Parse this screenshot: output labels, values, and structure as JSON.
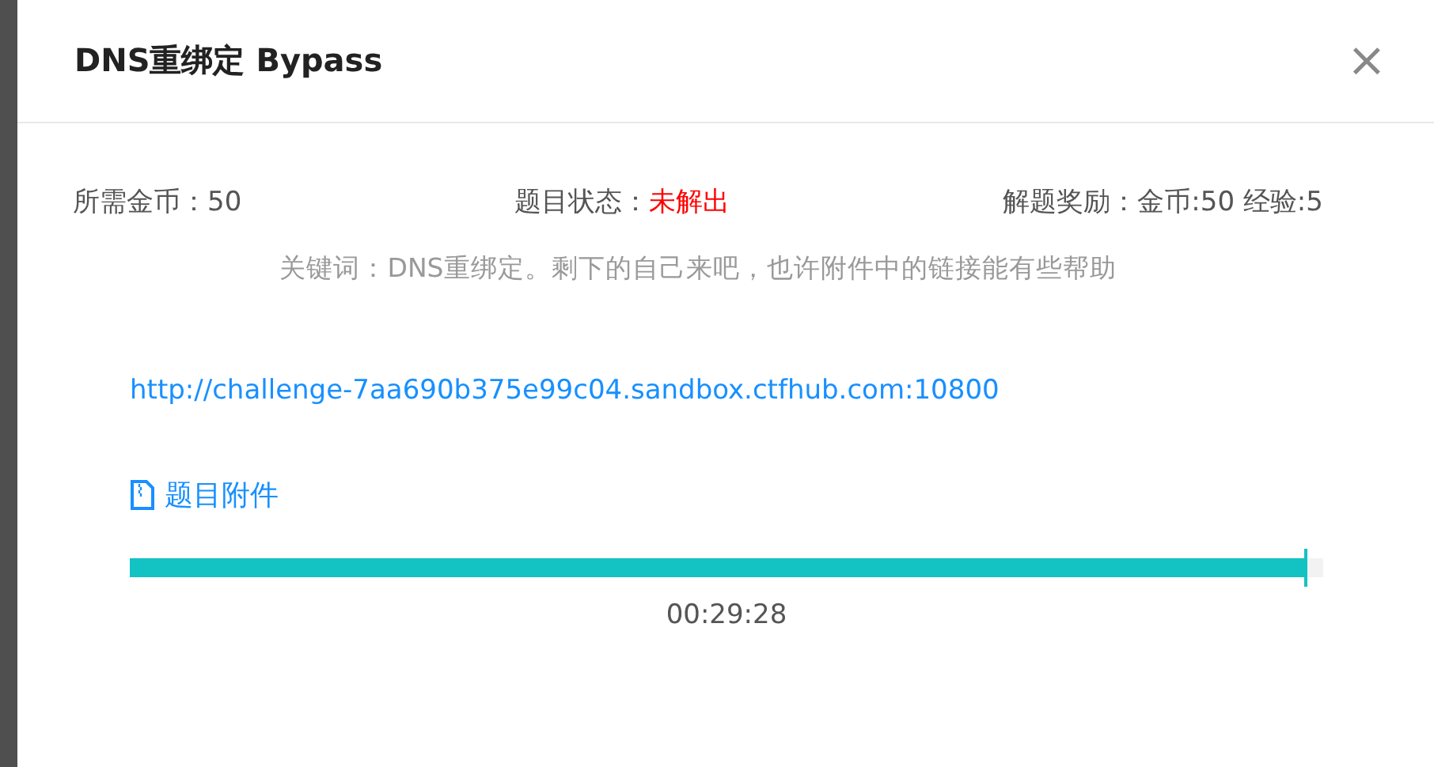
{
  "dialog": {
    "title": "DNS重绑定 Bypass",
    "close": "×"
  },
  "info": [
    {
      "label": "所需金币：",
      "value": "50",
      "kind": "plain"
    },
    {
      "label": "题目状态：",
      "value": "未解出",
      "kind": "alert"
    },
    {
      "label": "解题奖励：",
      "value": "金币:50 经验:5",
      "kind": "plain"
    }
  ],
  "keywords": "关键词：DNS重绑定。剩下的自己来吧，也许附件中的链接能有些帮助",
  "link": "http://challenge-7aa690b375e99c04.sandbox.ctfhub.com:10800",
  "attachment": "题目附件",
  "timer": {
    "reading": "00:29:28"
  }
}
